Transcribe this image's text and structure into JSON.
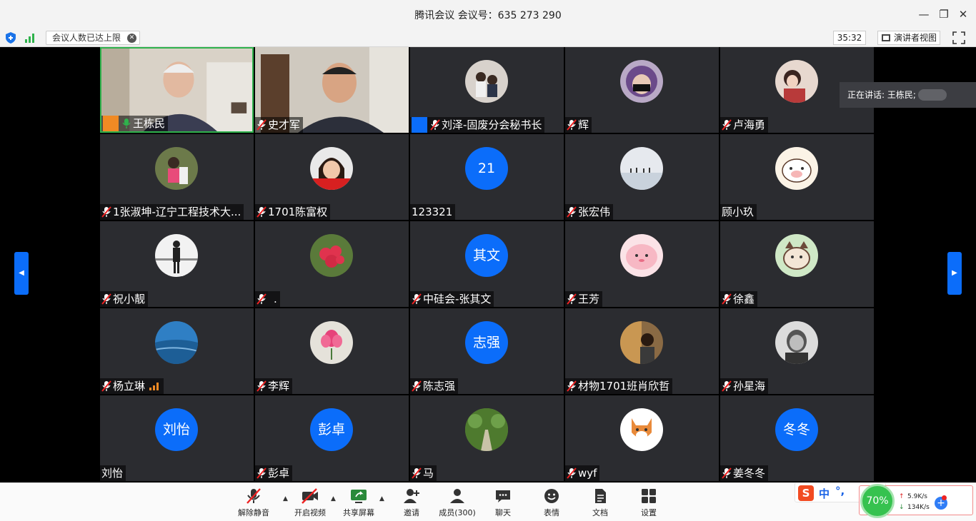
{
  "window": {
    "title": "腾讯会议 会议号：635 273 290",
    "minimize_glyph": "—",
    "restore_glyph": "❐",
    "close_glyph": "✕"
  },
  "infobar": {
    "notice": "会议人数已达上限",
    "notice_close": "✕",
    "timer": "35:32",
    "speaker_view": "演讲者视图"
  },
  "speaking": {
    "label": "正在讲话: 王栋民;"
  },
  "nav": {
    "left_glyph": "◀",
    "right_glyph": "▶"
  },
  "participants": [
    {
      "name": "王栋民",
      "mic": "on",
      "host_badge": "orange"
    },
    {
      "name": "史才军",
      "mic": "muted"
    },
    {
      "name": "刘泽-固废分会秘书长",
      "mic": "muted",
      "host_badge": "blue"
    },
    {
      "name": "辉",
      "mic": "muted"
    },
    {
      "name": "卢海勇",
      "mic": "muted"
    },
    {
      "name": "1张淑坤-辽宁工程技术大...",
      "mic": "muted"
    },
    {
      "name": "1701陈富权",
      "mic": "muted"
    },
    {
      "name": "123321",
      "mic": "none",
      "avatar_text": "21"
    },
    {
      "name": "张宏伟",
      "mic": "muted"
    },
    {
      "name": "顾小玖",
      "mic": "none"
    },
    {
      "name": "祝小靓",
      "mic": "muted"
    },
    {
      "name": ".",
      "mic": "muted"
    },
    {
      "name": "中硅会-张其文",
      "mic": "muted",
      "avatar_text": "其文"
    },
    {
      "name": "王芳",
      "mic": "muted"
    },
    {
      "name": "徐鑫",
      "mic": "muted"
    },
    {
      "name": "杨立琳",
      "mic": "muted"
    },
    {
      "name": "李辉",
      "mic": "muted"
    },
    {
      "name": "陈志强",
      "mic": "muted",
      "avatar_text": "志强"
    },
    {
      "name": "材物1701班肖欣哲",
      "mic": "muted"
    },
    {
      "name": "孙星海",
      "mic": "muted"
    },
    {
      "name": "刘怡",
      "mic": "none",
      "avatar_text": "刘怡"
    },
    {
      "name": "彭卓",
      "mic": "muted",
      "avatar_text": "彭卓"
    },
    {
      "name": "马",
      "mic": "muted"
    },
    {
      "name": "wyf",
      "mic": "muted"
    },
    {
      "name": "姜冬冬",
      "mic": "muted",
      "avatar_text": "冬冬"
    }
  ],
  "toolbar": {
    "unmute": "解除静音",
    "start_video": "开启视频",
    "share_screen": "共享屏幕",
    "invite": "邀请",
    "members": "成员(300)",
    "chat": "聊天",
    "reactions": "表情",
    "documents": "文档",
    "settings": "设置"
  },
  "ime": {
    "logo": "S",
    "mode": "中",
    "punct": "°,",
    "network_quality": "70%",
    "upload": "5.9K/s",
    "download": "134K/s"
  },
  "colors": {
    "accent": "#0b6dfa",
    "tile_bg": "#2b2c30",
    "active_border": "#2fb24c",
    "host_orange": "#f08a24"
  }
}
